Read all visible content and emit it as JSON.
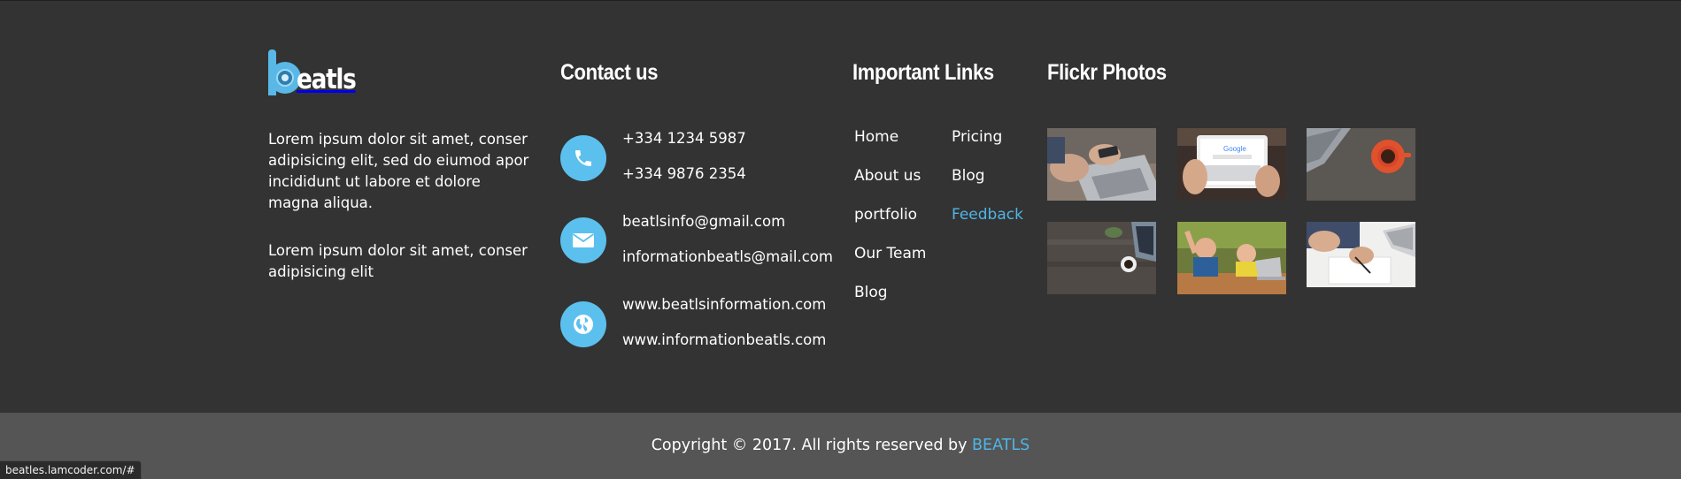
{
  "brand": {
    "logo_text": "eatls",
    "logo_color": "#59b8e6"
  },
  "about": {
    "paragraph_1": "Lorem ipsum dolor sit amet, conser adipisicing elit, sed do eiumod apor incididunt ut labore et dolore magna aliqua.",
    "paragraph_2": "Lorem ipsum dolor sit amet, conser adipisicing elit"
  },
  "contact": {
    "heading": "Contact us",
    "phone_icon": "phone-icon",
    "phone_1": "+334 1234 5987",
    "phone_2": "+334 9876 2354",
    "email_icon": "envelope-icon",
    "email_1": "beatlsinfo@gmail.com",
    "email_2": "informationbeatls@mail.com",
    "web_icon": "globe-icon",
    "web_1": "www.beatlsinformation.com",
    "web_2": "www.informationbeatls.com",
    "icon_bg_color": "#5bc0ee"
  },
  "links": {
    "heading": "Important Links",
    "left": [
      "Home",
      "About us",
      "portfolio",
      "Our Team",
      "Blog"
    ],
    "right": [
      "Pricing",
      "Blog",
      "Feedback"
    ],
    "active_link": "Feedback",
    "active_color": "#4fb5e7"
  },
  "flickr": {
    "heading": "Flickr Photos",
    "photos": [
      "laptop-and-phone-photo",
      "tablet-google-search-photo",
      "laptop-and-coffee-photo",
      "desk-with-laptop-and-cup-photo",
      "kids-cheering-at-laptop-photo",
      "person-writing-notes-photo"
    ]
  },
  "footer": {
    "copyright_text": "Copyright © 2017. All rights reserved by ",
    "copyright_brand": "BEATLS"
  },
  "status_bar": {
    "url": "beatles.lamcoder.com/#"
  },
  "colors": {
    "footer_bg": "#333333",
    "bottom_bar_bg": "#555555",
    "accent": "#4fb5e7"
  }
}
